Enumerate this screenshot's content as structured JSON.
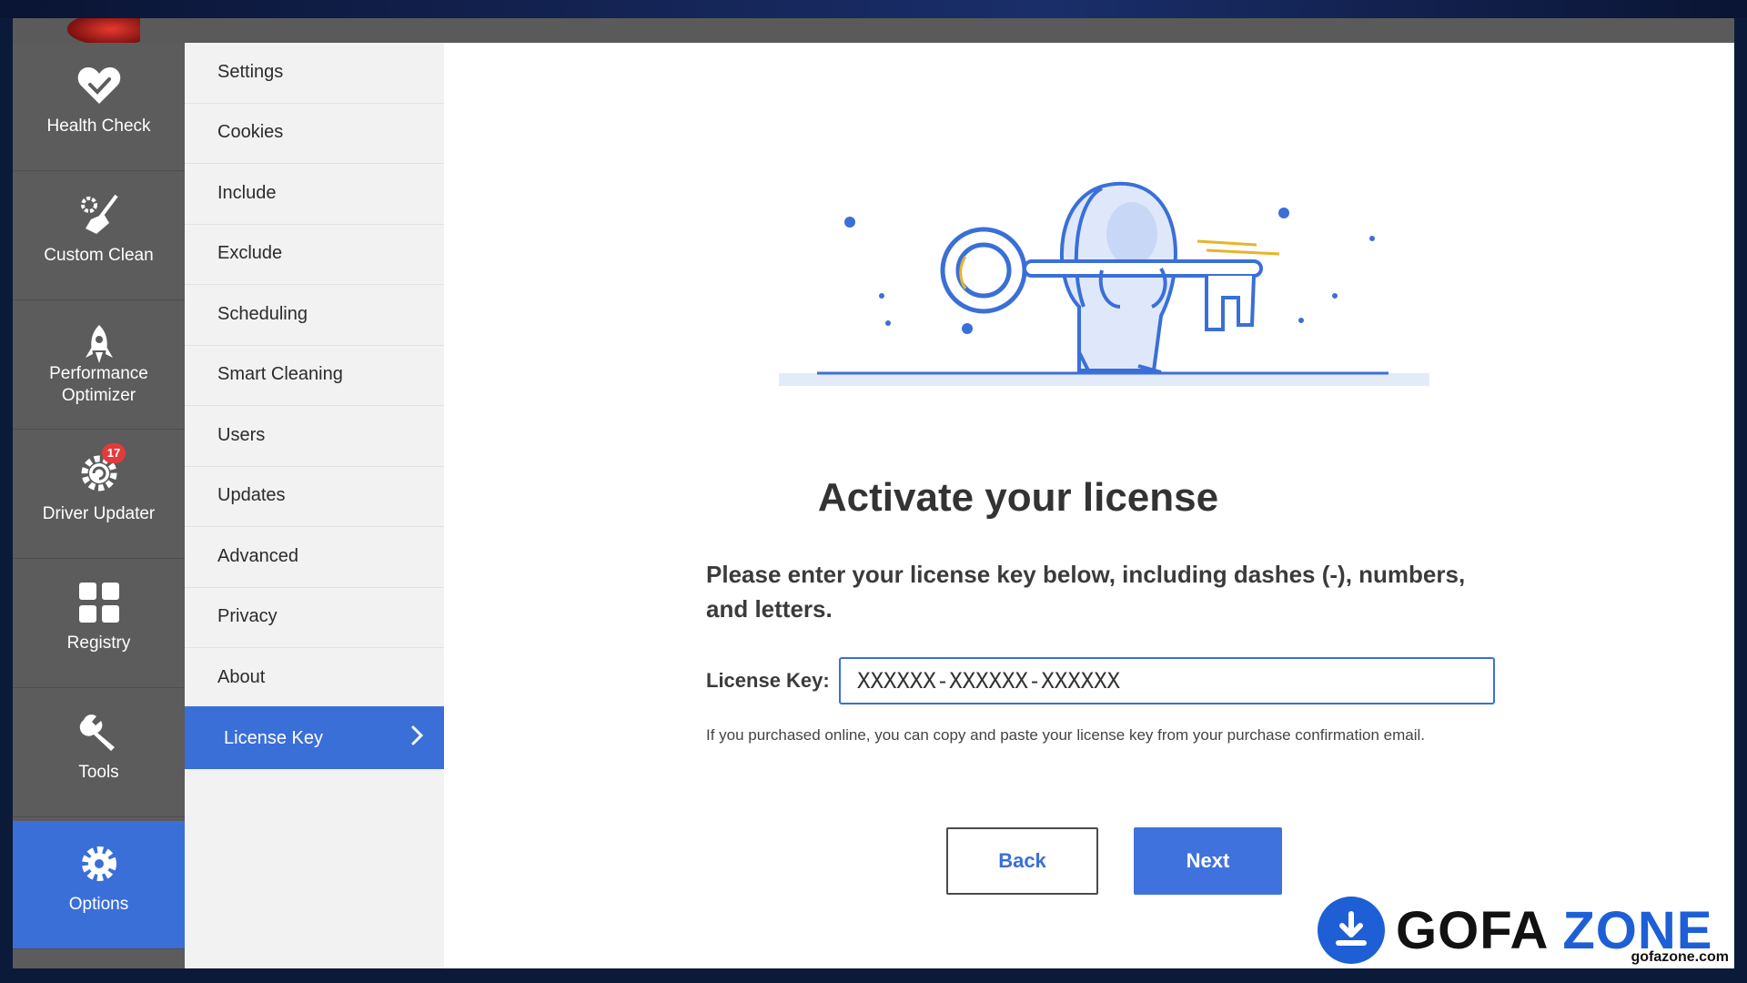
{
  "colors": {
    "accent": "#3a6fd8",
    "nav_bg": "#5c5c5c",
    "submenu_bg": "#f2f2f2",
    "badge": "#e23b3b"
  },
  "nav": {
    "items": [
      {
        "label": "Health Check",
        "icon": "heart-check-icon"
      },
      {
        "label": "Custom Clean",
        "icon": "broom-gear-icon"
      },
      {
        "label": "Performance Optimizer",
        "icon": "rocket-icon"
      },
      {
        "label": "Driver Updater",
        "icon": "gear-refresh-icon",
        "badge": "17"
      },
      {
        "label": "Registry",
        "icon": "grid-icon"
      },
      {
        "label": "Tools",
        "icon": "wrench-icon"
      },
      {
        "label": "Options",
        "icon": "gear-icon",
        "active": true
      }
    ]
  },
  "submenu": {
    "items": [
      {
        "label": "Settings"
      },
      {
        "label": "Cookies"
      },
      {
        "label": "Include"
      },
      {
        "label": "Exclude"
      },
      {
        "label": "Scheduling"
      },
      {
        "label": "Smart Cleaning"
      },
      {
        "label": "Users"
      },
      {
        "label": "Updates"
      },
      {
        "label": "Advanced"
      },
      {
        "label": "Privacy"
      },
      {
        "label": "About"
      },
      {
        "label": "License Key",
        "active": true
      }
    ]
  },
  "main": {
    "heading": "Activate your license",
    "instruction": "Please enter your license key below, including dashes (-), numbers, and letters.",
    "license_label": "License Key:",
    "license_value": "XXXXXX-XXXXXX-XXXXXX",
    "hint": "If you purchased online, you can copy and paste your license key from your purchase confirmation email.",
    "back_label": "Back",
    "next_label": "Next"
  },
  "watermark": {
    "brand_left": "GOFA",
    "brand_right": "ZONE",
    "site": "gofazone.com"
  }
}
